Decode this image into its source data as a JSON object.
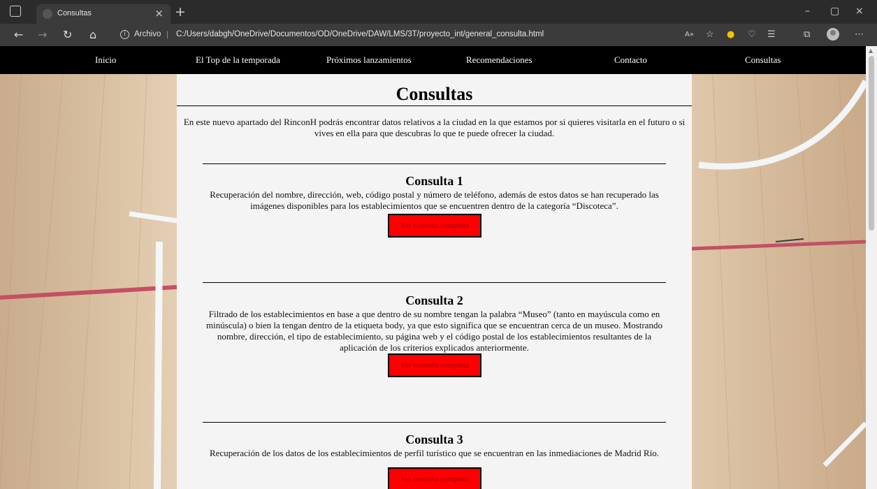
{
  "browser": {
    "tab_title": "Consultas",
    "tab_close": "×",
    "new_tab": "+",
    "window_controls": [
      "–",
      "▢",
      "×"
    ],
    "icons": [
      "back-arrow-icon",
      "forward-arrow-icon",
      "refresh-icon",
      "home-icon",
      "info-icon",
      "read-aloud-icon",
      "add-favorite-icon",
      "extension-icon",
      "favorites-icon",
      "collections-icon",
      "profile-icon",
      "more-icon"
    ],
    "address": {
      "scheme_label": "Archivo",
      "separator": "|",
      "url": "C:/Users/dabgh/OneDrive/Documentos/OD/OneDrive/DAW/LMS/3T/proyecto_int/general_consulta.html"
    }
  },
  "nav": {
    "items": [
      "Inicio",
      "El Top de la temporada",
      "Próximos lanzamientos",
      "Recomendaciones",
      "Contacto",
      "Consultas"
    ]
  },
  "page": {
    "title": "Consultas",
    "intro": "En este nuevo apartado del RinconH podrás encontrar datos relativos a la ciudad en la que estamos por si quieres visitarla en el futuro o si vives en ella para que descubras lo que te puede ofrecer la ciudad.",
    "sections": [
      {
        "title": "Consulta 1",
        "description": "Recuperación del nombre, dirección, web, código postal y número de teléfono, además de estos datos se han recuperado las imágenes disponibles para los establecimientos que se encuentren dentro de la categoría “Discoteca”.",
        "button": "Ver consulta completa"
      },
      {
        "title": "Consulta 2",
        "description": "Filtrado de los establecimientos en base a que dentro de su nombre tengan la palabra “Museo” (tanto en mayúscula como en minúscula) o bien la tengan dentro de la etiqueta body, ya que esto significa que se encuentran cerca de un museo. Mostrando nombre, dirección, el tipo de establecimiento, su página web y el código postal de los establecimientos resultantes de la aplicación de los criterios explicados anteriormente.",
        "button": "Ver consulta completa"
      },
      {
        "title": "Consulta 3",
        "description": "Recuperación de los datos de los establecimientos de perfil turístico que se encuentran en las inmediaciones de Madrid Río.",
        "button": "Ver consulta completa"
      }
    ]
  },
  "colors": {
    "nav_bg": "#000000",
    "content_bg": "#f4f4f4",
    "button_bg": "#ff0000",
    "button_text": "#a80000",
    "browser_toolbar": "#3b3b3b"
  }
}
